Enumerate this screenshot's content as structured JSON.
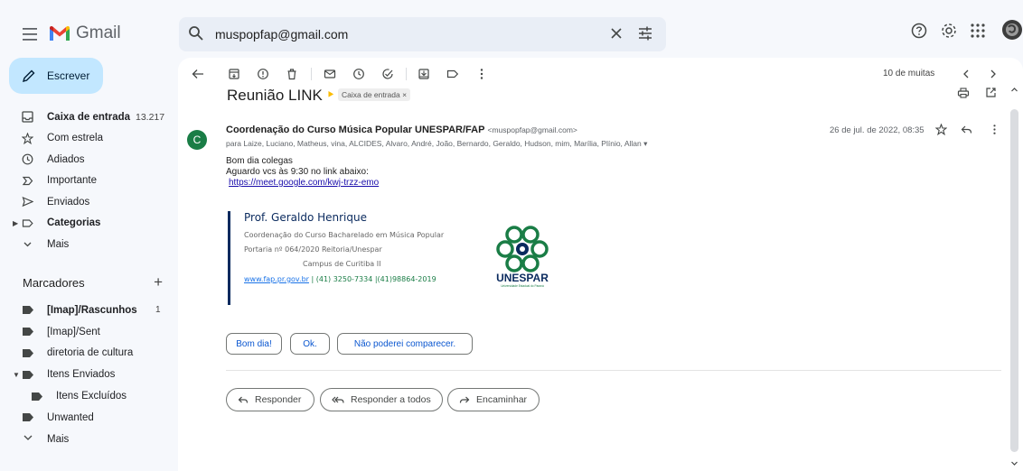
{
  "app": {
    "name": "Gmail"
  },
  "colors": {
    "accent": "#0b57d0",
    "compose_bg": "#c2e7ff",
    "avatar_bg": "#1a7d46",
    "sig_blue": "#0a2a5e",
    "sig_green": "#1a7d46"
  },
  "search": {
    "value": "muspopfap@gmail.com"
  },
  "sidebar": {
    "compose_label": "Escrever",
    "items": [
      {
        "label": "Caixa de entrada",
        "count": "13.217",
        "icon": "inbox-icon"
      },
      {
        "label": "Com estrela",
        "icon": "star-icon"
      },
      {
        "label": "Adiados",
        "icon": "clock-icon"
      },
      {
        "label": "Importante",
        "icon": "important-icon"
      },
      {
        "label": "Enviados",
        "icon": "send-icon"
      },
      {
        "label": "Categorias",
        "icon": "label-icon"
      },
      {
        "label": "Mais",
        "icon": "chevron-down-icon"
      }
    ],
    "labels_heading": "Marcadores",
    "labels": [
      {
        "label": "[Imap]/Rascunhos",
        "count": "1"
      },
      {
        "label": "[Imap]/Sent"
      },
      {
        "label": "diretoria de cultura"
      },
      {
        "label": "Itens Enviados"
      },
      {
        "label": "Itens Excluídos"
      },
      {
        "label": "Unwanted"
      },
      {
        "label": "Mais"
      }
    ]
  },
  "message": {
    "pager": "10 de muitas",
    "subject": "Reunião LINK",
    "folder_chip": "Caixa de entrada ×",
    "avatar_letter": "C",
    "sender_name": "Coordenação do Curso Música Popular UNESPAR/FAP",
    "sender_email": "<muspopfap@gmail.com>",
    "recipients": "para Laize, Luciano, Matheus, vina, ALCIDES, Alvaro, André, João, Bernardo, Geraldo, Hudson, mim, Marília, Plínio, Allan ▾",
    "date": "26 de jul. de 2022, 08:35",
    "body_lines": [
      "Bom dia colegas",
      "Aguardo vcs às 9:30 no link abaixo:"
    ],
    "link": "https://meet.google.com/kwj-trzz-emo",
    "signature": {
      "name": "Prof. Geraldo Henrique",
      "line1": "Coordenação do Curso Bacharelado em Música Popular",
      "line2": "Portaria nº 064/2020 Reitoria/Unespar",
      "line3": "Campus de Curitiba II",
      "website": "www.fap.pr.gov.br",
      "phones": " | (41) 3250-7334 |(41)98864-2019",
      "logo_text": "UNESPAR",
      "logo_subtext": "Universidade Estadual do Paraná"
    },
    "smart_replies": [
      "Bom dia!",
      "Ok.",
      "Não poderei comparecer."
    ],
    "actions": {
      "reply": "Responder",
      "reply_all": "Responder a todos",
      "forward": "Encaminhar"
    }
  }
}
